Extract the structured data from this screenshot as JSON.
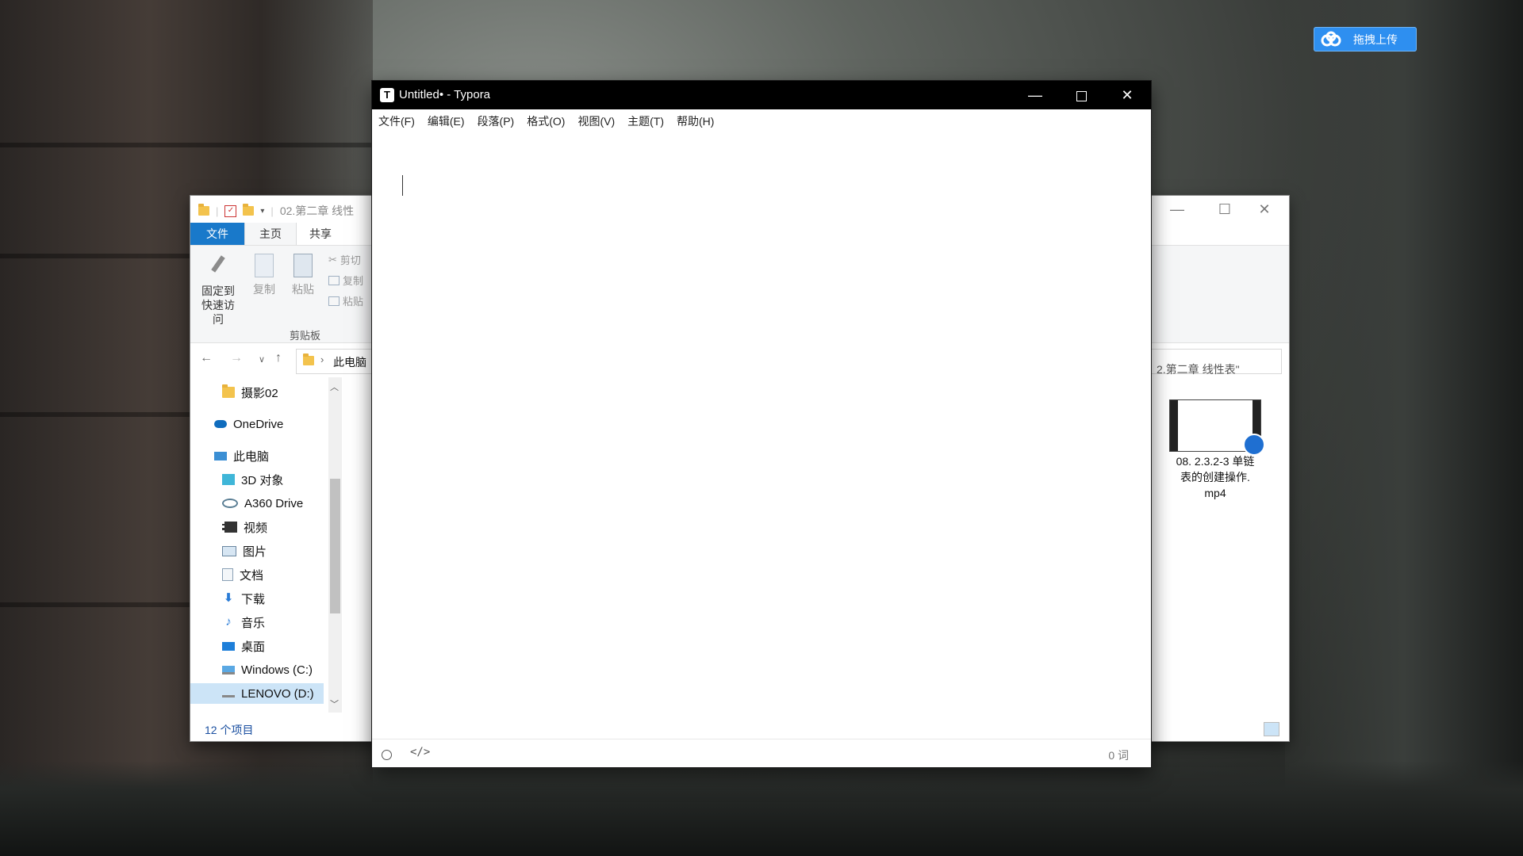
{
  "desktop": {
    "upload_label": "拖拽上传"
  },
  "explorer": {
    "title": "02.第二章 线性",
    "tabs": [
      "文件",
      "主页",
      "共享"
    ],
    "ribbon": {
      "pin_label_1": "固定到",
      "pin_label_2": "快速访问",
      "copy_label": "复制",
      "paste_label": "粘贴",
      "cut_label": "剪切",
      "copy_path_label": "复制",
      "paste_shortcut_label": "粘贴",
      "group_label": "剪贴板"
    },
    "address": {
      "crumb": "此电脑",
      "search_placeholder": "2.第二章 线性表\""
    },
    "nav_items": [
      {
        "label": "摄影02",
        "icon": "folder-icon"
      },
      {
        "label": "OneDrive",
        "icon": "onedrive-icon"
      },
      {
        "label": "此电脑",
        "icon": "this-pc-icon"
      },
      {
        "label": "3D 对象",
        "icon": "3d-objects-icon"
      },
      {
        "label": "A360 Drive",
        "icon": "a360-drive-icon"
      },
      {
        "label": "视频",
        "icon": "videos-icon"
      },
      {
        "label": "图片",
        "icon": "pictures-icon"
      },
      {
        "label": "文档",
        "icon": "documents-icon"
      },
      {
        "label": "下载",
        "icon": "downloads-icon"
      },
      {
        "label": "音乐",
        "icon": "music-icon"
      },
      {
        "label": "桌面",
        "icon": "desktop-icon"
      },
      {
        "label": "Windows (C:)",
        "icon": "drive-c-icon"
      },
      {
        "label": "LENOVO (D:)",
        "icon": "drive-d-icon"
      }
    ],
    "file": {
      "name_line1": "08. 2.3.2-3 单链",
      "name_line2": "表的创建操作.",
      "name_line3": "mp4"
    },
    "status_count": "12 个项目"
  },
  "typora": {
    "title": "Untitled• - Typora",
    "menu": [
      "文件(F)",
      "编辑(E)",
      "段落(P)",
      "格式(O)",
      "视图(V)",
      "主题(T)",
      "帮助(H)"
    ],
    "code_toggle": "</>",
    "word_count": "0 词"
  }
}
